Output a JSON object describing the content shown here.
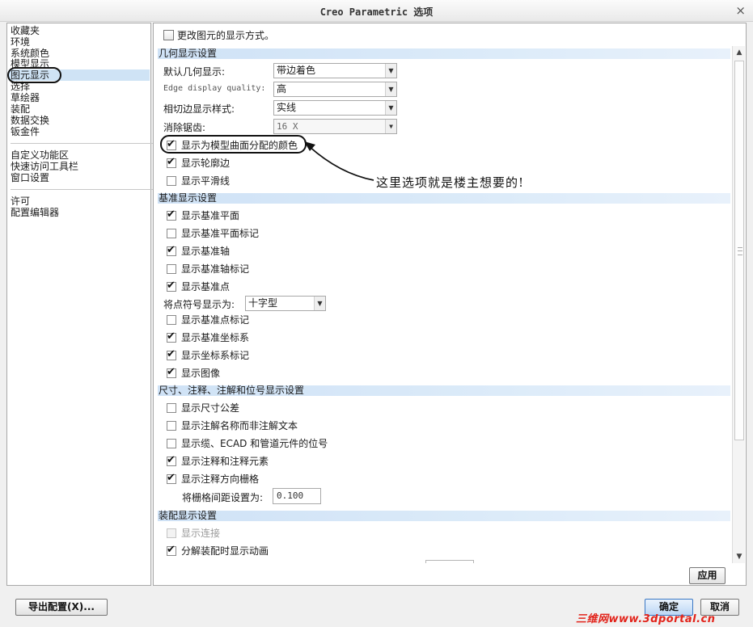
{
  "window": {
    "title": "Creo Parametric 选项",
    "close_glyph": "×"
  },
  "sidebar": {
    "groups": [
      [
        "收藏夹",
        "环境",
        "系统颜色",
        "模型显示",
        "图元显示",
        "选择",
        "草绘器",
        "装配",
        "数据交换",
        "钣金件"
      ],
      [
        "自定义功能区",
        "快速访问工具栏",
        "窗口设置"
      ],
      [
        "许可",
        "配置编辑器"
      ]
    ],
    "selected": "图元显示"
  },
  "main": {
    "intro": "更改图元的显示方式。",
    "sections": {
      "geometry": {
        "title": "几何显示设置",
        "rows": [
          {
            "label": "默认几何显示:",
            "value": "带边着色"
          },
          {
            "label": "Edge display quality:",
            "value": "高"
          },
          {
            "label": "相切边显示样式:",
            "value": "实线"
          },
          {
            "label": "消除锯齿:",
            "value": "16 X"
          }
        ],
        "checks": [
          {
            "label": "显示为模型曲面分配的颜色",
            "checked": true
          },
          {
            "label": "显示轮廓边",
            "checked": true
          },
          {
            "label": "显示平滑线",
            "checked": false
          }
        ]
      },
      "datum": {
        "title": "基准显示设置",
        "checks_a": [
          {
            "label": "显示基准平面",
            "checked": true
          },
          {
            "label": "显示基准平面标记",
            "checked": false
          },
          {
            "label": "显示基准轴",
            "checked": true
          },
          {
            "label": "显示基准轴标记",
            "checked": false
          },
          {
            "label": "显示基准点",
            "checked": true
          }
        ],
        "point_symbol_label": "将点符号显示为:",
        "point_symbol_value": "十字型",
        "checks_b": [
          {
            "label": "显示基准点标记",
            "checked": false
          },
          {
            "label": "显示基准坐标系",
            "checked": true
          },
          {
            "label": "显示坐标系标记",
            "checked": true
          },
          {
            "label": "显示图像",
            "checked": true
          }
        ]
      },
      "annotation": {
        "title": "尺寸、注释、注解和位号显示设置",
        "checks": [
          {
            "label": "显示尺寸公差",
            "checked": false
          },
          {
            "label": "显示注解名称而非注解文本",
            "checked": false
          },
          {
            "label": "显示缆、ECAD 和管道元件的位号",
            "checked": false
          },
          {
            "label": "显示注释和注释元素",
            "checked": true
          },
          {
            "label": "显示注释方向栅格",
            "checked": true
          }
        ],
        "grid_label": "将栅格间距设置为:",
        "grid_value": "0.100"
      },
      "assembly": {
        "title": "装配显示设置",
        "checks": [
          {
            "label": "显示连接",
            "checked": false,
            "disabled": true
          },
          {
            "label": "分解装配时显示动画",
            "checked": true
          }
        ]
      }
    },
    "callout": "这里选项就是楼主想要的!",
    "apply_button": "应用"
  },
  "footer": {
    "export_button": "导出配置(X)...",
    "ok_button": "确定",
    "cancel_button": "取消"
  },
  "watermark": "三维网www.3dportal.cn",
  "colors": {
    "section_bg": "#cfe2f6",
    "selected_bg": "#cfe3f5",
    "watermark": "#e2231a"
  }
}
